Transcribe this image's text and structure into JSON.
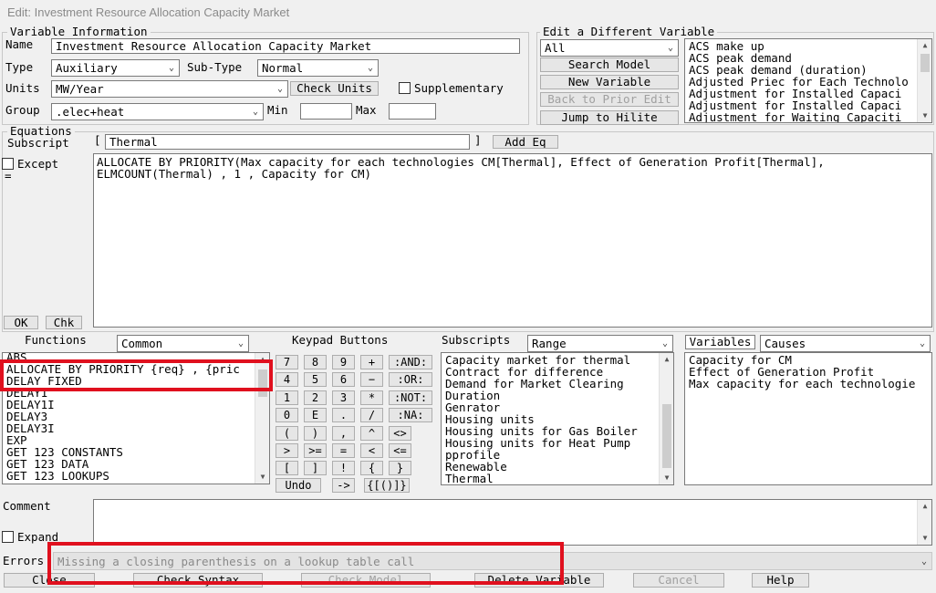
{
  "window": {
    "title": "Edit: Investment Resource Allocation Capacity Market"
  },
  "variable_information": {
    "legend": "Variable Information",
    "name_label": "Name",
    "name_value": "Investment Resource Allocation Capacity Market",
    "type_label": "Type",
    "type_value": "Auxiliary",
    "subtype_label": "Sub-Type",
    "subtype_value": "Normal",
    "units_label": "Units",
    "units_value": "MW/Year",
    "check_units_label": "Check Units",
    "supplementary_label": "Supplementary",
    "group_label": "Group",
    "group_value": ".elec+heat",
    "min_label": "Min",
    "max_label": "Max"
  },
  "edit_different": {
    "legend": "Edit a Different Variable",
    "filter_value": "All",
    "search_model_label": "Search Model",
    "new_variable_label": "New Variable",
    "back_to_prior_label": "Back to Prior Edit",
    "jump_to_hilite_label": "Jump to Hilite",
    "variables": [
      "ACS make up",
      "ACS peak demand",
      "ACS peak demand (duration)",
      "Adjusted Priec for Each Technolo",
      "Adjustment for Installed Capaci",
      "Adjustment for Installed Capaci",
      "Adjustment for Waiting Capaciti"
    ]
  },
  "equations": {
    "legend": "Equations",
    "subscript_label": "Subscript",
    "subscript_open": "[",
    "subscript_value": "Thermal",
    "subscript_close": "]",
    "add_eq_label": "Add Eq",
    "except_label": "Except",
    "equals_sign": "=",
    "equation_text": "ALLOCATE BY PRIORITY(Max capacity for each technologies CM[Thermal], Effect of Generation Profit[Thermal],\nELMCOUNT(Thermal) , 1 , Capacity for CM)",
    "ok_label": "OK",
    "chk_label": "Chk"
  },
  "functions": {
    "label": "Functions",
    "category_value": "Common",
    "items": [
      "ABS",
      "ALLOCATE BY PRIORITY {req} , {pric",
      "DELAY FIXED",
      "DELAY1",
      "DELAY1I",
      "DELAY3",
      "DELAY3I",
      "EXP",
      "GET 123 CONSTANTS",
      "GET 123 DATA",
      "GET 123 LOOKUPS"
    ]
  },
  "keypad": {
    "label": "Keypad Buttons",
    "digits": [
      "7",
      "8",
      "9",
      "4",
      "5",
      "6",
      "1",
      "2",
      "3",
      "0",
      "E",
      "."
    ],
    "operators": [
      "+",
      "−",
      "*",
      "/"
    ],
    "logic": [
      ":AND:",
      ":OR:",
      ":NOT:",
      ":NA:"
    ],
    "row5": [
      "(",
      ")",
      ",",
      "^",
      "<>"
    ],
    "row6": [
      ">",
      ">=",
      "=",
      "<",
      "<="
    ],
    "row7": [
      "[",
      "]",
      "!",
      "{",
      "}"
    ],
    "undo_label": "Undo",
    "arrow_label": "->",
    "brackets_label": "{[()]}"
  },
  "subscripts": {
    "label": "Subscripts",
    "mode_value": "Range",
    "items": [
      "Capacity market for thermal",
      "Contract for difference",
      "Demand for Market Clearing",
      "Duration",
      "Genrator",
      "Housing units",
      "Housing units for Gas Boiler",
      "Housing units for Heat Pump",
      "pprofile",
      "Renewable",
      "Thermal"
    ]
  },
  "variables_panel": {
    "label": "Variables",
    "mode_value": "Causes",
    "items": [
      "Capacity for CM",
      "Effect of Generation Profit",
      "Max capacity for each technologie"
    ]
  },
  "comment": {
    "label": "Comment",
    "expand_label": "Expand"
  },
  "errors": {
    "label": "Errors",
    "message": "Missing a closing parenthesis on a lookup table call"
  },
  "footer": {
    "close_label": "Close",
    "check_syntax_label": "Check Syntax",
    "check_model_label": "Check Model",
    "delete_variable_label": "Delete Variable",
    "cancel_label": "Cancel",
    "help_label": "Help"
  },
  "colors": {
    "highlight_box": "#e0101e",
    "window_bg": "#f0f0f0",
    "disabled_text": "#a0a0a0"
  }
}
